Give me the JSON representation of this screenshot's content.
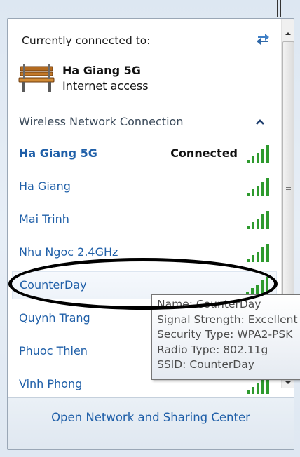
{
  "header": {
    "title": "Currently connected to:",
    "refresh_icon": "refresh-network-icon"
  },
  "current_network": {
    "icon": "bench-icon",
    "name": "Ha Giang 5G",
    "status": "Internet access"
  },
  "section": {
    "label": "Wireless Network Connection",
    "collapse_icon": "chevron-up-icon"
  },
  "networks": [
    {
      "ssid": "Ha Giang 5G",
      "status": "Connected",
      "signal_bars": 5
    },
    {
      "ssid": "Ha Giang",
      "status": "",
      "signal_bars": 5
    },
    {
      "ssid": "Mai Trinh",
      "status": "",
      "signal_bars": 5
    },
    {
      "ssid": "Nhu Ngoc 2.4GHz",
      "status": "",
      "signal_bars": 5
    },
    {
      "ssid": "CounterDay",
      "status": "",
      "signal_bars": 5
    },
    {
      "ssid": "Quynh Trang",
      "status": "",
      "signal_bars": 5
    },
    {
      "ssid": "Phuoc Thien",
      "status": "",
      "signal_bars": 5
    },
    {
      "ssid": "Vinh Phong",
      "status": "",
      "signal_bars": 5
    }
  ],
  "tooltip": {
    "name": "Name: CounterDay",
    "signal": "Signal Strength: Excellent",
    "security": "Security Type: WPA2-PSK",
    "radio": "Radio Type: 802.11g",
    "ssid": "SSID: CounterDay"
  },
  "footer": {
    "link": "Open Network and Sharing Center"
  },
  "colors": {
    "link": "#1f5fa8",
    "signal_green": "#2e9a2e",
    "panel_bg": "#ffffff",
    "footer_bg": "#e3eaf2"
  }
}
